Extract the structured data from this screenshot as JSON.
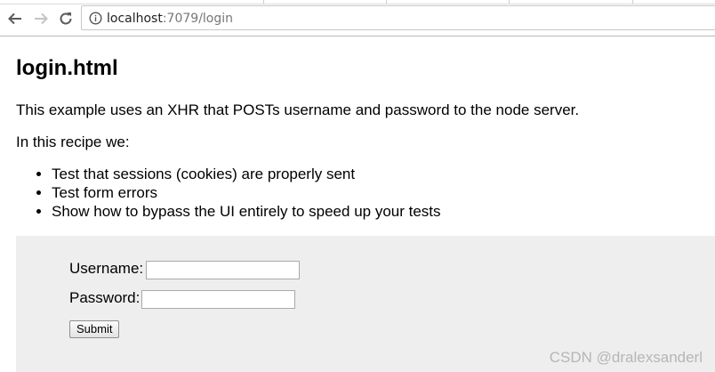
{
  "browser": {
    "url_host": "localhost",
    "url_rest": ":7079/login"
  },
  "page": {
    "heading": "login.html",
    "intro": "This example uses an XHR that POSTs username and password to the node server.",
    "recipe_intro": "In this recipe we:",
    "recipe_items": [
      "Test that sessions (cookies) are properly sent",
      "Test form errors",
      "Show how to bypass the UI entirely to speed up your tests"
    ]
  },
  "form": {
    "username_label": "Username:",
    "username_value": "",
    "password_label": "Password:",
    "password_value": "",
    "submit_label": "Submit"
  },
  "watermark": "CSDN @dralexsanderl",
  "colors": {
    "form_background": "#eeeeee",
    "url_host": "#222222",
    "url_rest": "#777777"
  },
  "icons": {
    "back": "arrow-left",
    "forward": "arrow-right",
    "reload": "refresh",
    "site_info": "info-circle"
  }
}
